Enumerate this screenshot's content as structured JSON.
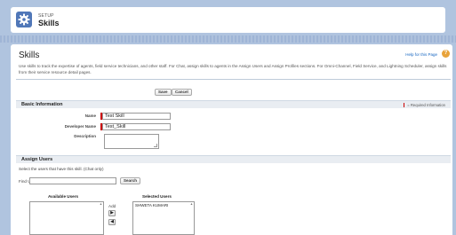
{
  "setup": {
    "small_label": "SETUP",
    "title": "Skills",
    "icon": "gear-icon"
  },
  "page": {
    "title": "Skills",
    "help_link": "Help for this Page",
    "help_icon": "?",
    "description": "Use skills to track the expertise of agents, field service technicians, and other staff. For Chat, assign skills to agents in the Assign Users and Assign Profiles sections. For Omni-Channel, Field Service, and Lightning Scheduler, assign skills from their service resource detail pages."
  },
  "buttons": {
    "save": "Save",
    "cancel": "Cancel",
    "search": "Search"
  },
  "basic_info": {
    "heading": "Basic Information",
    "required_legend": "= Required Information",
    "name_label": "Name",
    "name_value": "Test Skill",
    "developer_name_label": "Developer Name",
    "developer_name_value": "Test_Skill",
    "description_label": "Description",
    "description_value": ""
  },
  "assign_users": {
    "heading": "Assign Users",
    "instruction": "Select the users that have this skill. (Chat only)",
    "find_users_label": "Find Users",
    "find_users_value": "",
    "available_label": "Available Users",
    "selected_label": "Selected Users",
    "add_label": "Add",
    "available_users": [],
    "selected_users": [
      "SHWETA KUMARI"
    ],
    "add_arrow": "▶",
    "remove_arrow": "◀"
  },
  "colors": {
    "background": "#b0c4df",
    "setup_icon": "#5077b8",
    "required": "#cc0000",
    "link": "#1565c0"
  }
}
